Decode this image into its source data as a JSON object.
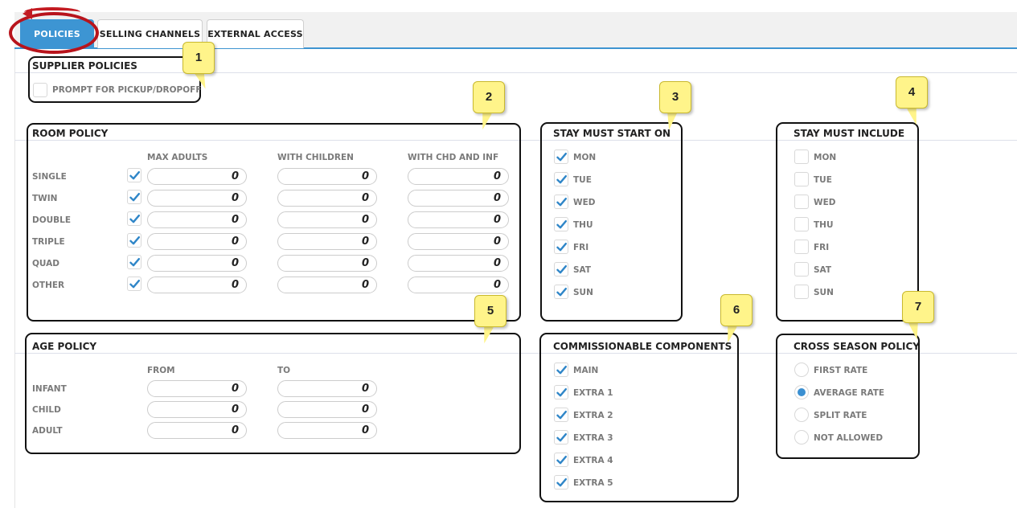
{
  "tabs": {
    "policies": "POLICIES",
    "selling_channels": "SELLING CHANNELS",
    "external_access": "EXTERNAL ACCESS"
  },
  "supplier": {
    "title": "SUPPLIER POLICIES",
    "pickup_label": "PROMPT FOR PICKUP/DROPOFF",
    "pickup_checked": false
  },
  "room": {
    "title": "ROOM POLICY",
    "columns": [
      "MAX ADULTS",
      "WITH CHILDREN",
      "WITH CHD AND INF"
    ],
    "rows": [
      {
        "label": "SINGLE",
        "checked": true,
        "values": [
          "0",
          "0",
          "0"
        ]
      },
      {
        "label": "TWIN",
        "checked": true,
        "values": [
          "0",
          "0",
          "0"
        ]
      },
      {
        "label": "DOUBLE",
        "checked": true,
        "values": [
          "0",
          "0",
          "0"
        ]
      },
      {
        "label": "TRIPLE",
        "checked": true,
        "values": [
          "0",
          "0",
          "0"
        ]
      },
      {
        "label": "QUAD",
        "checked": true,
        "values": [
          "0",
          "0",
          "0"
        ]
      },
      {
        "label": "OTHER",
        "checked": true,
        "values": [
          "0",
          "0",
          "0"
        ]
      }
    ]
  },
  "age": {
    "title": "AGE POLICY",
    "columns": [
      "FROM",
      "TO"
    ],
    "rows": [
      {
        "label": "INFANT",
        "values": [
          "0",
          "0"
        ]
      },
      {
        "label": "CHILD",
        "values": [
          "0",
          "0"
        ]
      },
      {
        "label": "ADULT",
        "values": [
          "0",
          "0"
        ]
      }
    ]
  },
  "stay_start": {
    "title": "STAY MUST START ON",
    "days": [
      {
        "label": "MON",
        "checked": true
      },
      {
        "label": "TUE",
        "checked": true
      },
      {
        "label": "WED",
        "checked": true
      },
      {
        "label": "THU",
        "checked": true
      },
      {
        "label": "FRI",
        "checked": true
      },
      {
        "label": "SAT",
        "checked": true
      },
      {
        "label": "SUN",
        "checked": true
      }
    ]
  },
  "stay_include": {
    "title": "STAY MUST INCLUDE",
    "days": [
      {
        "label": "MON",
        "checked": false
      },
      {
        "label": "TUE",
        "checked": false
      },
      {
        "label": "WED",
        "checked": false
      },
      {
        "label": "THU",
        "checked": false
      },
      {
        "label": "FRI",
        "checked": false
      },
      {
        "label": "SAT",
        "checked": false
      },
      {
        "label": "SUN",
        "checked": false
      }
    ]
  },
  "commission": {
    "title": "COMMISSIONABLE COMPONENTS",
    "items": [
      {
        "label": "MAIN",
        "checked": true
      },
      {
        "label": "EXTRA 1",
        "checked": true
      },
      {
        "label": "EXTRA 2",
        "checked": true
      },
      {
        "label": "EXTRA 3",
        "checked": true
      },
      {
        "label": "EXTRA 4",
        "checked": true
      },
      {
        "label": "EXTRA 5",
        "checked": true
      }
    ]
  },
  "cross_season": {
    "title": "CROSS SEASON POLICY",
    "options": [
      {
        "label": "FIRST RATE",
        "selected": false
      },
      {
        "label": "AVERAGE RATE",
        "selected": true
      },
      {
        "label": "SPLIT RATE",
        "selected": false
      },
      {
        "label": "NOT ALLOWED",
        "selected": false
      }
    ]
  },
  "callouts": [
    "1",
    "2",
    "3",
    "4",
    "5",
    "6",
    "7"
  ],
  "colors": {
    "accent": "#3d95d3",
    "check": "#2f86c8",
    "callout_fill": "#fff48a",
    "highlight_ring": "#b8141c"
  }
}
